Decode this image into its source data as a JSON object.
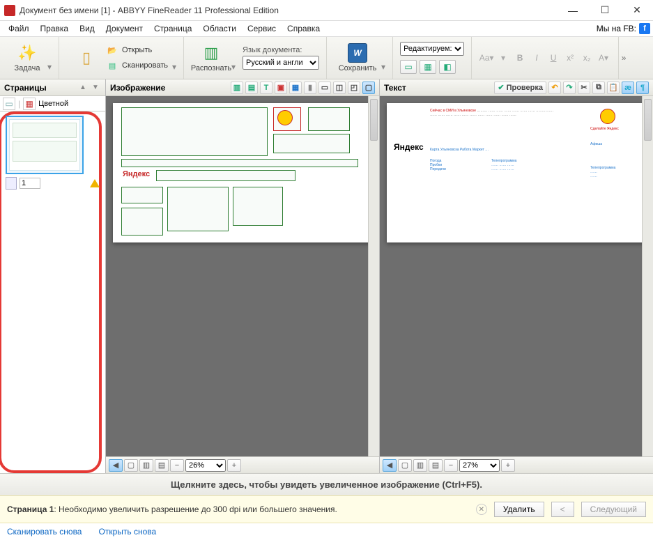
{
  "title": "Документ без имени [1] - ABBYY FineReader 11 Professional Edition",
  "menus": [
    "Файл",
    "Правка",
    "Вид",
    "Документ",
    "Страница",
    "Области",
    "Сервис",
    "Справка"
  ],
  "fb_label": "Мы на FB:",
  "toolbar": {
    "task": "Задача",
    "open": "Открыть",
    "scan": "Сканировать",
    "recognize": "Распознать",
    "lang_label": "Язык документа:",
    "lang_value": "Русский и англи",
    "save": "Сохранить",
    "edit_mode": "Редактируем:"
  },
  "pages": {
    "title": "Страницы",
    "mode": "Цветной",
    "page_num": "1"
  },
  "image_pane": {
    "title": "Изображение",
    "zoom": "26%"
  },
  "text_pane": {
    "title": "Текст",
    "check": "Проверка",
    "zoom": "27%"
  },
  "hint": "Щелкните здесь, чтобы увидеть увеличенное изображение (Ctrl+F5).",
  "warn": {
    "prefix": "Страница 1",
    "msg": ": Необходимо увеличить разрешение до 300 dpi или большего значения.",
    "delete": "Удалить",
    "prev": "<",
    "next": "Следующий"
  },
  "links": {
    "rescan": "Сканировать снова",
    "reopen": "Открыть снова"
  },
  "doc": {
    "yandex": "Яндекс"
  }
}
